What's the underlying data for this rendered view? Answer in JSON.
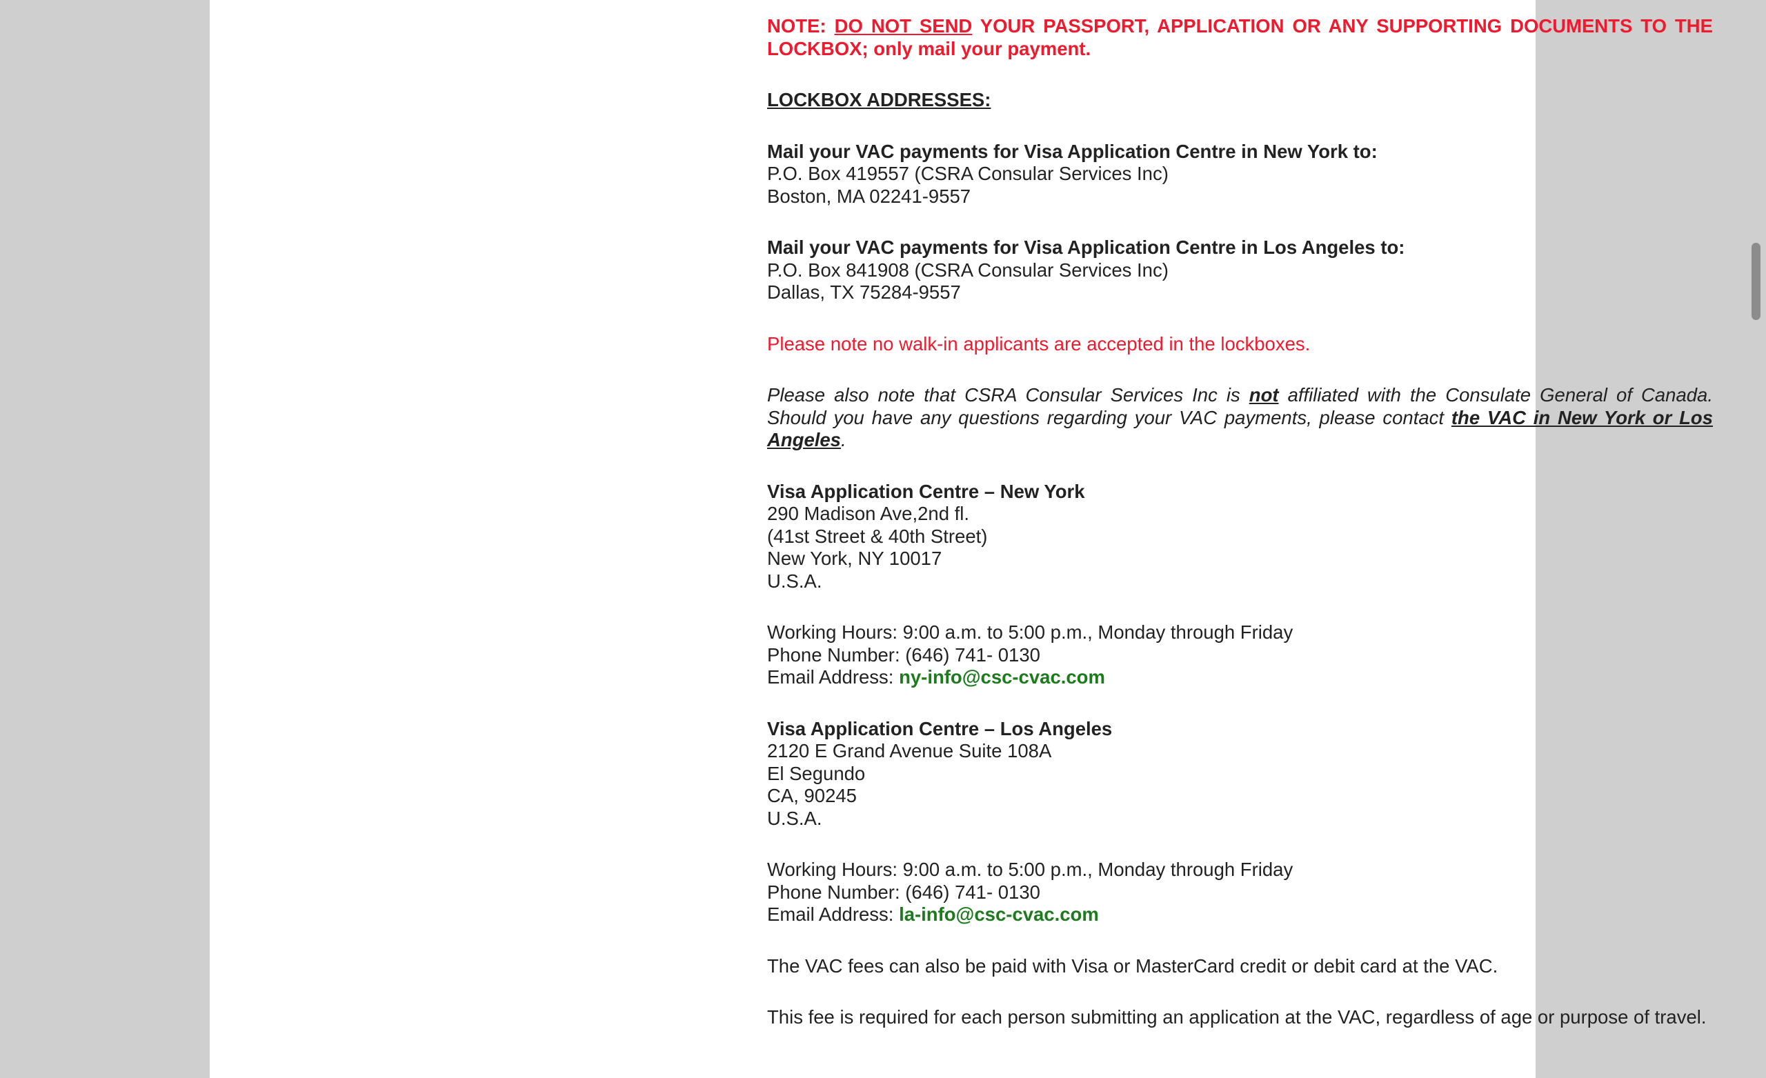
{
  "note": {
    "label": "NOTE:",
    "emphasis": "DO NOT SEND",
    "rest": " YOUR PASSPORT, APPLICATION OR ANY SUPPORTING DOCUMENTS TO THE LOCKBOX; only mail your payment."
  },
  "lockbox": {
    "heading": "LOCKBOX ADDRESSES:",
    "ny": {
      "title": "Mail your VAC payments for Visa Application Centre in New York to:",
      "line1": "P.O. Box 419557 (CSRA Consular Services Inc)",
      "line2": "Boston, MA 02241-9557"
    },
    "la": {
      "title": "Mail your VAC payments for Visa Application Centre in Los Angeles to:",
      "line1": "P.O. Box 841908 (CSRA Consular Services Inc)",
      "line2": "Dallas, TX 75284-9557"
    }
  },
  "walkin_note": "Please note no walk-in applicants are accepted in the lockboxes.",
  "affiliation": {
    "before": "Please also note that CSRA Consular Services Inc is ",
    "not": "not",
    "middle": " affiliated with the Consulate General of Canada. Should you have any questions regarding your VAC payments, please contact ",
    "link": "the VAC in New York or Los Angeles",
    "after": "."
  },
  "vac_ny": {
    "title": "Visa Application Centre – New York",
    "line1": "290 Madison Ave,2nd fl.",
    "line2": "(41st Street & 40th Street)",
    "line3": "New York, NY 10017",
    "line4": "U.S.A.",
    "hours": "Working Hours: 9:00 a.m. to 5:00 p.m., Monday through Friday",
    "phone": "Phone Number: (646) 741- 0130",
    "email_label": "Email Address: ",
    "email": "ny-info@csc-cvac.com"
  },
  "vac_la": {
    "title": "Visa Application Centre – Los Angeles",
    "line1": "2120 E Grand Avenue Suite 108A",
    "line2": "El Segundo",
    "line3": "CA, 90245",
    "line4": "U.S.A.",
    "hours": "Working Hours: 9:00 a.m. to 5:00 p.m., Monday through Friday",
    "phone": "Phone Number: (646) 741- 0130",
    "email_label": "Email Address: ",
    "email": "la-info@csc-cvac.com"
  },
  "card_note": "The VAC fees can also be paid with Visa or MasterCard credit or debit card at the VAC.",
  "fee_note": "This fee is required for each person submitting an application at the VAC, regardless of age or purpose of travel.",
  "colors": {
    "red": "#ee1a2e",
    "link_green": "#1d7a1d",
    "text": "#222222",
    "background": "#cfcfcf"
  }
}
